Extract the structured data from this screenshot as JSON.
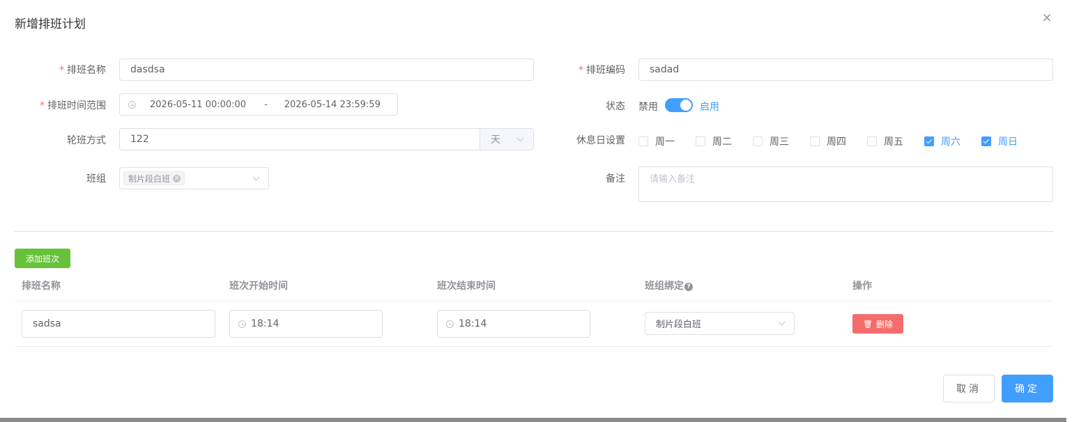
{
  "dialog": {
    "title": "新增排班计划",
    "close_icon": "close-icon"
  },
  "form": {
    "schedule_name": {
      "required": "*",
      "label": "排班名称",
      "value": "dasdsa"
    },
    "schedule_code": {
      "required": "*",
      "label": "排班编码",
      "value": "sadad"
    },
    "time_range": {
      "required": "*",
      "label": "排班时间范围",
      "start": "2026-05-11 00:00:00",
      "separator": "-",
      "end": "2026-05-14 23:59:59"
    },
    "status": {
      "label": "状态",
      "off_text": "禁用",
      "on_text": "启用",
      "enabled": true
    },
    "rotation": {
      "label": "轮班方式",
      "value": "122",
      "unit": "天"
    },
    "rest_days": {
      "label": "休息日设置",
      "options": [
        {
          "label": "周一",
          "checked": false
        },
        {
          "label": "周二",
          "checked": false
        },
        {
          "label": "周三",
          "checked": false
        },
        {
          "label": "周四",
          "checked": false
        },
        {
          "label": "周五",
          "checked": false
        },
        {
          "label": "周六",
          "checked": true
        },
        {
          "label": "周日",
          "checked": true
        }
      ]
    },
    "team": {
      "label": "班组",
      "tags": [
        "制片段白班"
      ]
    },
    "remark": {
      "label": "备注",
      "placeholder": "请输入备注",
      "value": ""
    }
  },
  "shifts": {
    "add_button": "添加班次",
    "columns": [
      "排班名称",
      "班次开始时间",
      "班次结束时间",
      "班组绑定",
      "操作"
    ],
    "rows": [
      {
        "name": "sadsa",
        "start": "18:14",
        "end": "18:14",
        "team": "制片段白班",
        "delete_label": "删除"
      }
    ]
  },
  "footer": {
    "cancel": "取消",
    "confirm": "确定"
  },
  "colors": {
    "primary": "#409eff",
    "success": "#67c23a",
    "danger": "#f56c6c"
  }
}
